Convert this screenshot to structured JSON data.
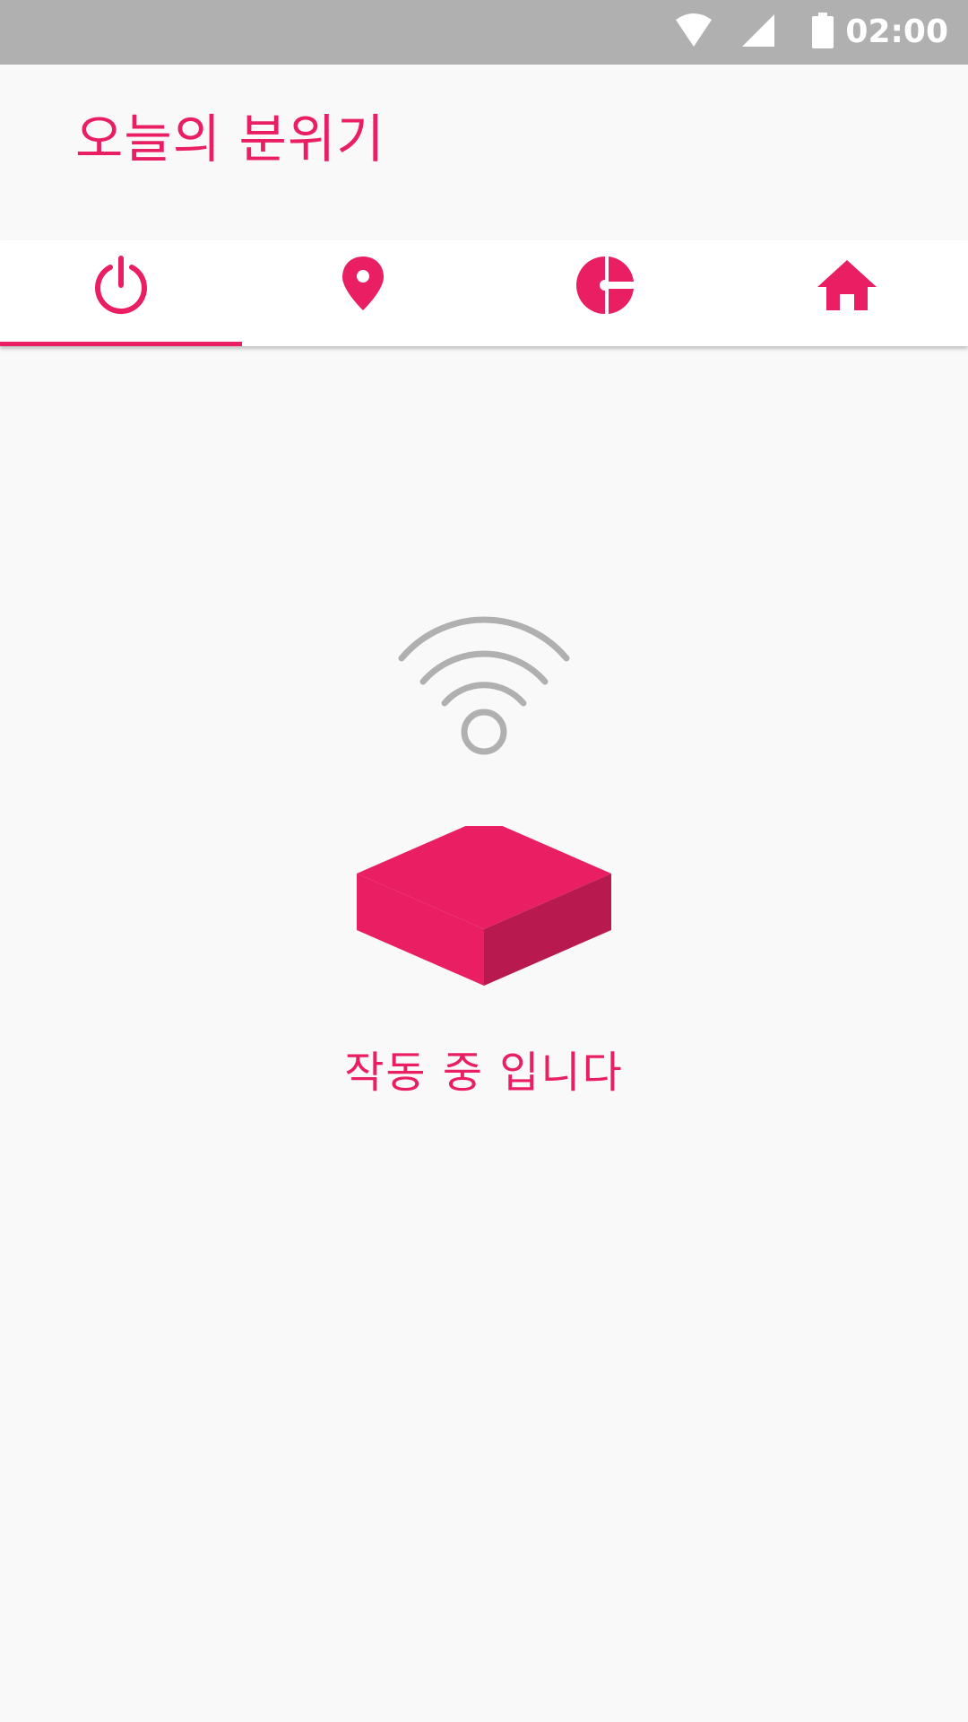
{
  "colors": {
    "accent": "#e91e63",
    "accent_dark": "#b81a4f",
    "status_bar": "#b0b0b0",
    "background": "#f9f9f9",
    "tab_bar": "#ffffff",
    "graphic_gray": "#b0b0b0"
  },
  "status_bar": {
    "time": "02:00",
    "icons": [
      "wifi-icon",
      "cell-signal-icon",
      "battery-icon"
    ]
  },
  "app_bar": {
    "title": "오늘의 분위기"
  },
  "tabs": [
    {
      "icon": "power-icon",
      "selected": true
    },
    {
      "icon": "location-pin-icon",
      "selected": false
    },
    {
      "icon": "pie-chart-icon",
      "selected": false
    },
    {
      "icon": "home-icon",
      "selected": false
    }
  ],
  "main": {
    "graphic_icons": [
      "wireless-signal-icon",
      "device-box-icon"
    ],
    "status_text": "작동 중 입니다"
  }
}
